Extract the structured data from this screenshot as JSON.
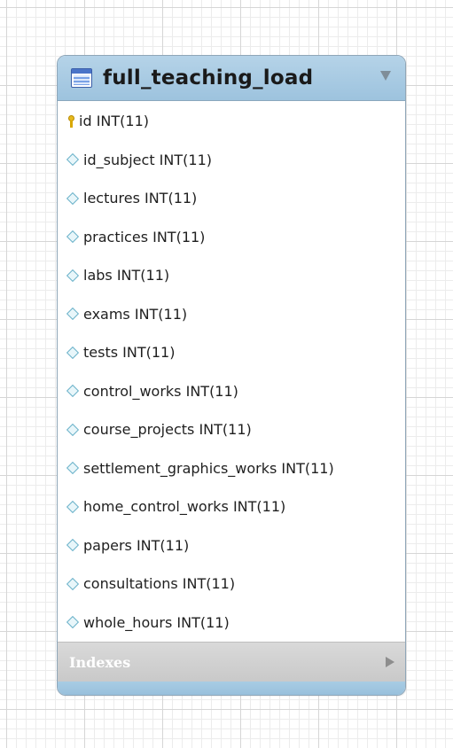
{
  "table": {
    "title": "full_teaching_load",
    "columns": [
      {
        "label": "id INT(11)",
        "key": "primary"
      },
      {
        "label": "id_subject INT(11)",
        "key": "none"
      },
      {
        "label": "lectures INT(11)",
        "key": "none"
      },
      {
        "label": "practices INT(11)",
        "key": "none"
      },
      {
        "label": "labs INT(11)",
        "key": "none"
      },
      {
        "label": "exams INT(11)",
        "key": "none"
      },
      {
        "label": "tests INT(11)",
        "key": "none"
      },
      {
        "label": "control_works INT(11)",
        "key": "none"
      },
      {
        "label": "course_projects INT(11)",
        "key": "none"
      },
      {
        "label": "settlement_graphics_works INT(11)",
        "key": "none"
      },
      {
        "label": "home_control_works INT(11)",
        "key": "none"
      },
      {
        "label": "papers INT(11)",
        "key": "none"
      },
      {
        "label": "consultations INT(11)",
        "key": "none"
      },
      {
        "label": "whole_hours INT(11)",
        "key": "none"
      }
    ],
    "indexes_label": "Indexes"
  },
  "colors": {
    "header": "#9dc3de",
    "border": "#8fa6b8",
    "column_icon": "#6bb2c9",
    "primary_key_icon": "#e6b91e"
  },
  "icons": {
    "table": "table-icon",
    "collapse": "chevron-down-icon",
    "primary_key": "key-icon",
    "column": "diamond-icon",
    "expand": "chevron-right-icon"
  }
}
